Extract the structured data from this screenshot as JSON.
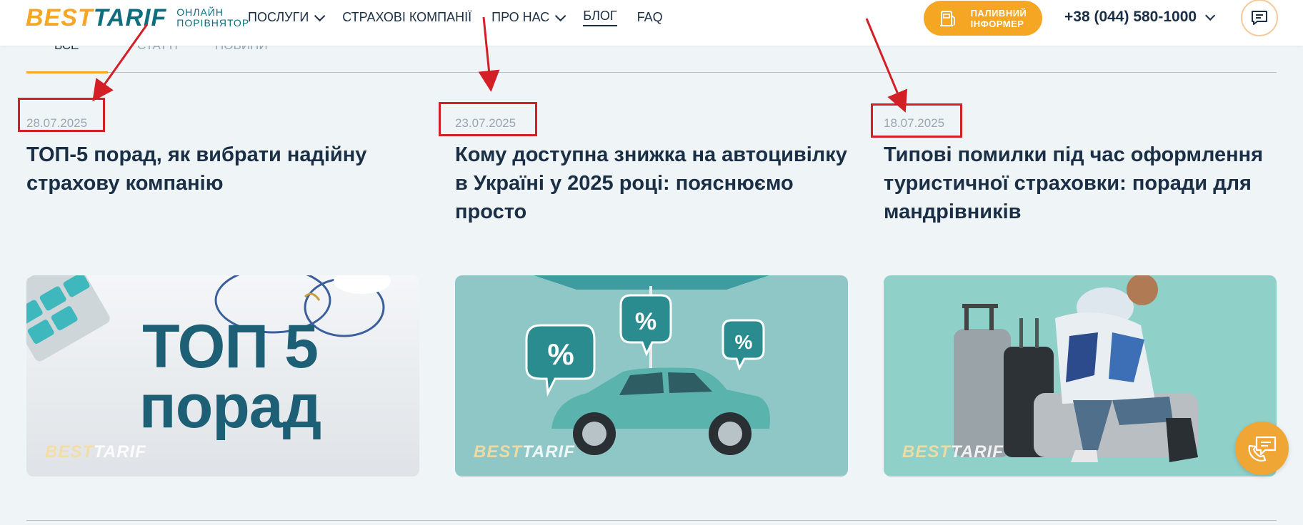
{
  "header": {
    "logo_brand_best": "BEST",
    "logo_brand_tarif": "TARIF",
    "logo_sub_line1": "ОНЛАЙН",
    "logo_sub_line2": "ПОРІВНЯТОР",
    "nav": [
      {
        "label": "ПОСЛУГИ",
        "dropdown": true
      },
      {
        "label": "СТРАХОВІ КОМПАНІЇ",
        "dropdown": false
      },
      {
        "label": "ПРО НАС",
        "dropdown": true
      },
      {
        "label": "БЛОГ",
        "dropdown": false,
        "active": true
      },
      {
        "label": "FAQ",
        "dropdown": false
      }
    ],
    "fuel_btn_line1": "ПАЛИВНИЙ",
    "fuel_btn_line2": "ІНФОРМЕР",
    "phone": "+38 (044) 580-1000"
  },
  "tabs": [
    {
      "label": "ВСЕ",
      "active": true
    },
    {
      "label": "СТАТТІ",
      "active": false
    },
    {
      "label": "НОВИНИ",
      "active": false
    }
  ],
  "articles": [
    {
      "date": "28.07.2025",
      "title": "ТОП-5 порад, як вибрати надійну страхову компанію",
      "image_text_line1": "ТОП 5",
      "image_text_line2": "порад",
      "watermark_best": "BEST",
      "watermark_tarif": "TARIF"
    },
    {
      "date": "23.07.2025",
      "title": "Кому доступна знижка на автоцивілку в Україні у 2025 році: пояснюємо просто",
      "watermark_best": "BEST",
      "watermark_tarif": "TARIF"
    },
    {
      "date": "18.07.2025",
      "title": "Типові помилки під час оформлення туристичної страховки: поради для мандрівників",
      "watermark_best": "BEST",
      "watermark_tarif": "TARIF"
    }
  ],
  "colors": {
    "accent": "#f5a623",
    "brand_teal": "#0f6d80",
    "annotation_red": "#d32027",
    "background": "#eff4f7"
  },
  "icons": [
    "chevron-down-icon",
    "fuel-pump-icon",
    "chat-icon",
    "phone-chat-icon"
  ]
}
